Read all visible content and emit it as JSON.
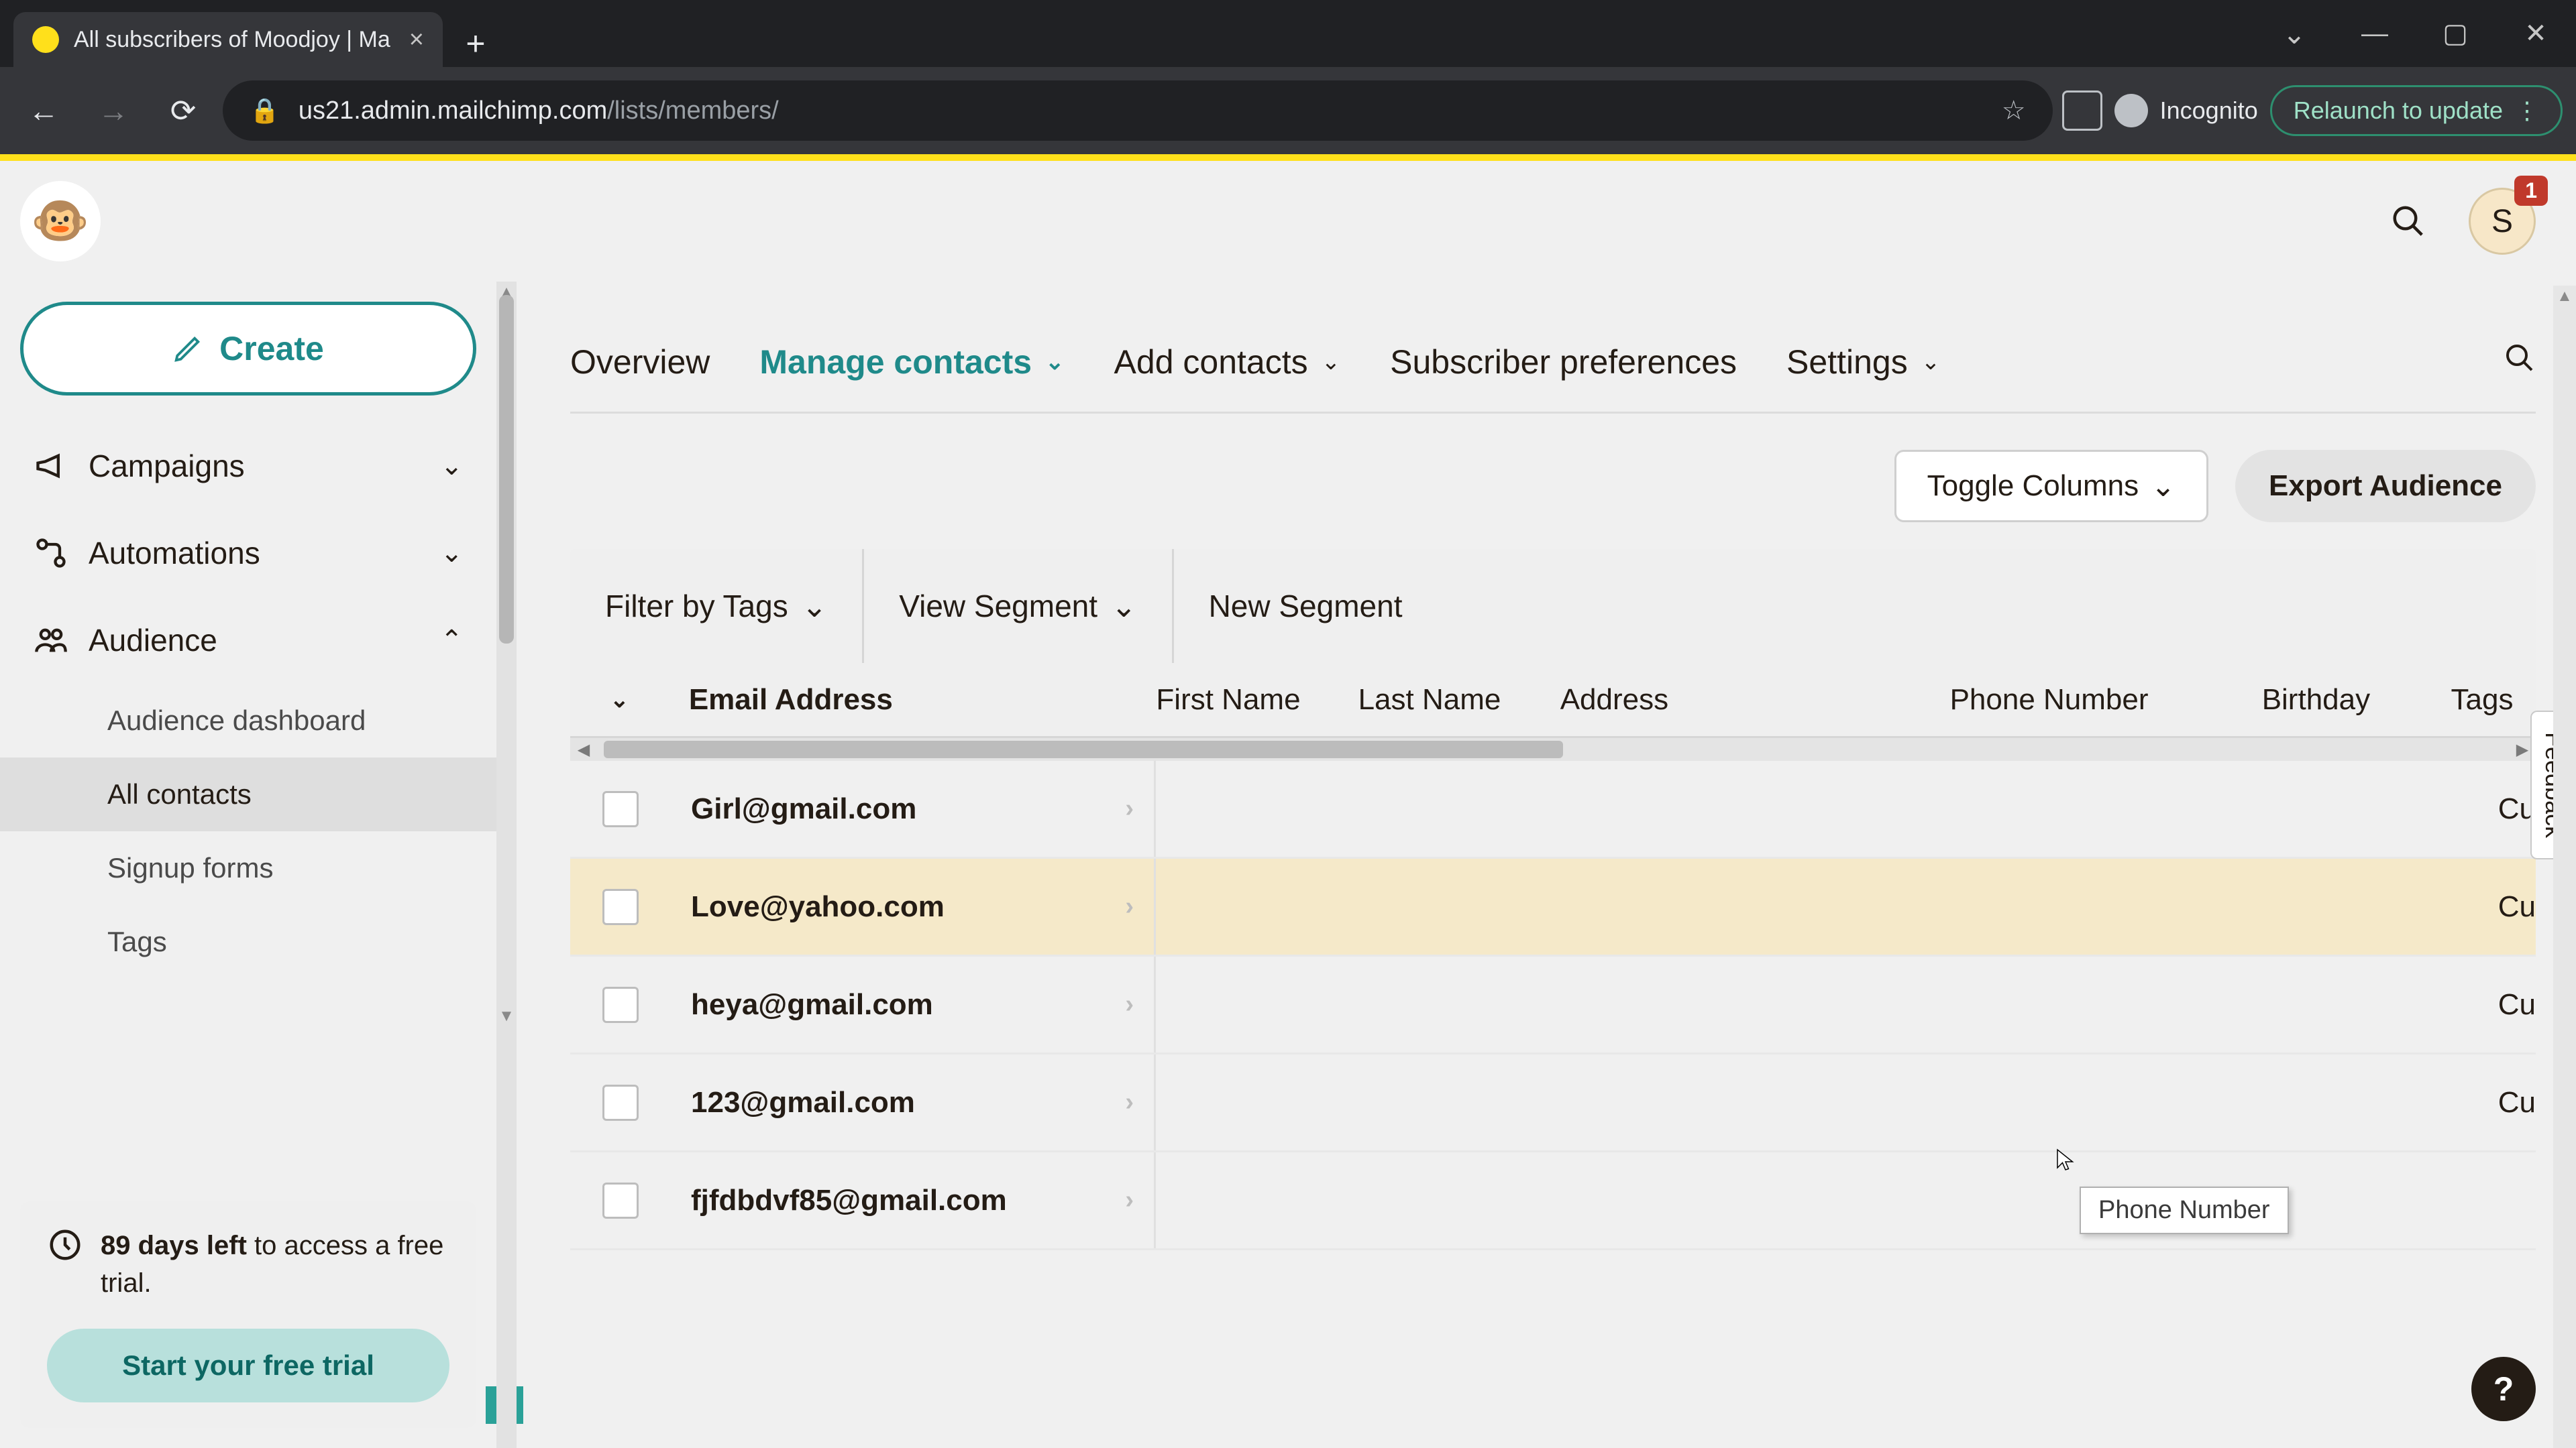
{
  "browser": {
    "tab_title": "All subscribers of Moodjoy | Ma",
    "url_domain": "us21.admin.mailchimp.com",
    "url_path": "/lists/members/",
    "incognito_label": "Incognito",
    "relaunch_label": "Relaunch to update"
  },
  "header": {
    "notifications": "1",
    "avatar_letter": "S"
  },
  "sidebar": {
    "create_label": "Create",
    "items": [
      {
        "label": "Campaigns",
        "expanded": false
      },
      {
        "label": "Automations",
        "expanded": false
      },
      {
        "label": "Audience",
        "expanded": true
      }
    ],
    "audience_children": [
      {
        "label": "Audience dashboard",
        "active": false
      },
      {
        "label": "All contacts",
        "active": true
      },
      {
        "label": "Signup forms",
        "active": false
      },
      {
        "label": "Tags",
        "active": false
      }
    ],
    "trial": {
      "days_left_bold": "89 days left",
      "rest": " to access a free trial.",
      "cta": "Start your free trial"
    }
  },
  "tabs": {
    "items": [
      {
        "label": "Overview",
        "active": false,
        "has_dd": false
      },
      {
        "label": "Manage contacts",
        "active": true,
        "has_dd": true
      },
      {
        "label": "Add contacts",
        "active": false,
        "has_dd": true
      },
      {
        "label": "Subscriber preferences",
        "active": false,
        "has_dd": false
      },
      {
        "label": "Settings",
        "active": false,
        "has_dd": true
      }
    ]
  },
  "toolbar": {
    "toggle_columns": "Toggle Columns",
    "export": "Export Audience"
  },
  "segment_bar": {
    "filter": "Filter by Tags",
    "view": "View Segment",
    "new": "New Segment"
  },
  "table": {
    "columns": [
      "Email Address",
      "First Name",
      "Last Name",
      "Address",
      "Phone Number",
      "Birthday",
      "Tags"
    ],
    "rows": [
      {
        "email": "Girl@gmail.com",
        "tags_clip": "Cu"
      },
      {
        "email": "Love@yahoo.com",
        "tags_clip": "Cu"
      },
      {
        "email": "heya@gmail.com",
        "tags_clip": "Cu"
      },
      {
        "email": "123@gmail.com",
        "tags_clip": "Cu"
      },
      {
        "email": "fjfdbdvf85@gmail.com",
        "tags_clip": ""
      }
    ],
    "hovered_row": 1,
    "tooltip": "Phone Number"
  },
  "misc": {
    "feedback": "Feedback",
    "help": "?"
  }
}
